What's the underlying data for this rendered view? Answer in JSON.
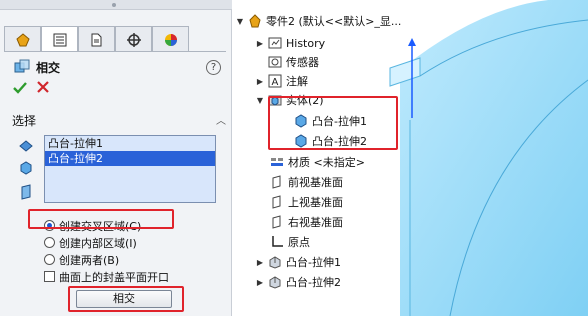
{
  "colors": {
    "highlight": "#e0232b",
    "selection": "#2a62d8",
    "body_blue": "#8fd7f7",
    "axis_blue": "#1a5bff"
  },
  "property_manager": {
    "tabs": [
      "feature-manager-icon",
      "property-manager-icon",
      "configuration-manager-icon",
      "dimxpert-icon",
      "display-manager-icon"
    ],
    "title": "相交",
    "help_label": "?",
    "section_title": "选择",
    "selections": [
      "凸台-拉伸1",
      "凸台-拉伸2"
    ],
    "options": [
      {
        "label": "创建交叉区域(C)",
        "type": "radio",
        "checked": true
      },
      {
        "label": "创建内部区域(I)",
        "type": "radio",
        "checked": false
      },
      {
        "label": "创建两者(B)",
        "type": "radio",
        "checked": false
      },
      {
        "label": "曲面上的封盖平面开口",
        "type": "checkbox",
        "checked": false
      }
    ],
    "apply_label": "相交"
  },
  "tree": {
    "root": "零件2 (默认<<默认>_显...",
    "items": {
      "history": "History",
      "sensors": "传感器",
      "annotations": "注解",
      "solid_bodies": "实体(2)",
      "body1": "凸台-拉伸1",
      "body2": "凸台-拉伸2",
      "material": "材质 <未指定>",
      "front_plane": "前视基准面",
      "top_plane": "上视基准面",
      "right_plane": "右视基准面",
      "origin": "原点",
      "feature1": "凸台-拉伸1",
      "feature2": "凸台-拉伸2"
    }
  }
}
